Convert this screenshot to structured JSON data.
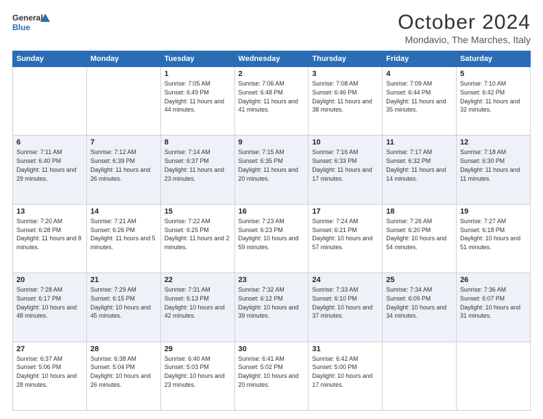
{
  "header": {
    "logo_line1": "General",
    "logo_line2": "Blue",
    "month": "October 2024",
    "location": "Mondavio, The Marches, Italy"
  },
  "weekdays": [
    "Sunday",
    "Monday",
    "Tuesday",
    "Wednesday",
    "Thursday",
    "Friday",
    "Saturday"
  ],
  "weeks": [
    [
      {
        "day": "",
        "sunrise": "",
        "sunset": "",
        "daylight": ""
      },
      {
        "day": "",
        "sunrise": "",
        "sunset": "",
        "daylight": ""
      },
      {
        "day": "1",
        "sunrise": "Sunrise: 7:05 AM",
        "sunset": "Sunset: 6:49 PM",
        "daylight": "Daylight: 11 hours and 44 minutes."
      },
      {
        "day": "2",
        "sunrise": "Sunrise: 7:06 AM",
        "sunset": "Sunset: 6:48 PM",
        "daylight": "Daylight: 11 hours and 41 minutes."
      },
      {
        "day": "3",
        "sunrise": "Sunrise: 7:08 AM",
        "sunset": "Sunset: 6:46 PM",
        "daylight": "Daylight: 11 hours and 38 minutes."
      },
      {
        "day": "4",
        "sunrise": "Sunrise: 7:09 AM",
        "sunset": "Sunset: 6:44 PM",
        "daylight": "Daylight: 11 hours and 35 minutes."
      },
      {
        "day": "5",
        "sunrise": "Sunrise: 7:10 AM",
        "sunset": "Sunset: 6:42 PM",
        "daylight": "Daylight: 11 hours and 32 minutes."
      }
    ],
    [
      {
        "day": "6",
        "sunrise": "Sunrise: 7:11 AM",
        "sunset": "Sunset: 6:40 PM",
        "daylight": "Daylight: 11 hours and 29 minutes."
      },
      {
        "day": "7",
        "sunrise": "Sunrise: 7:12 AM",
        "sunset": "Sunset: 6:39 PM",
        "daylight": "Daylight: 11 hours and 26 minutes."
      },
      {
        "day": "8",
        "sunrise": "Sunrise: 7:14 AM",
        "sunset": "Sunset: 6:37 PM",
        "daylight": "Daylight: 11 hours and 23 minutes."
      },
      {
        "day": "9",
        "sunrise": "Sunrise: 7:15 AM",
        "sunset": "Sunset: 6:35 PM",
        "daylight": "Daylight: 11 hours and 20 minutes."
      },
      {
        "day": "10",
        "sunrise": "Sunrise: 7:16 AM",
        "sunset": "Sunset: 6:33 PM",
        "daylight": "Daylight: 11 hours and 17 minutes."
      },
      {
        "day": "11",
        "sunrise": "Sunrise: 7:17 AM",
        "sunset": "Sunset: 6:32 PM",
        "daylight": "Daylight: 11 hours and 14 minutes."
      },
      {
        "day": "12",
        "sunrise": "Sunrise: 7:18 AM",
        "sunset": "Sunset: 6:30 PM",
        "daylight": "Daylight: 11 hours and 11 minutes."
      }
    ],
    [
      {
        "day": "13",
        "sunrise": "Sunrise: 7:20 AM",
        "sunset": "Sunset: 6:28 PM",
        "daylight": "Daylight: 11 hours and 8 minutes."
      },
      {
        "day": "14",
        "sunrise": "Sunrise: 7:21 AM",
        "sunset": "Sunset: 6:26 PM",
        "daylight": "Daylight: 11 hours and 5 minutes."
      },
      {
        "day": "15",
        "sunrise": "Sunrise: 7:22 AM",
        "sunset": "Sunset: 6:25 PM",
        "daylight": "Daylight: 11 hours and 2 minutes."
      },
      {
        "day": "16",
        "sunrise": "Sunrise: 7:23 AM",
        "sunset": "Sunset: 6:23 PM",
        "daylight": "Daylight: 10 hours and 59 minutes."
      },
      {
        "day": "17",
        "sunrise": "Sunrise: 7:24 AM",
        "sunset": "Sunset: 6:21 PM",
        "daylight": "Daylight: 10 hours and 57 minutes."
      },
      {
        "day": "18",
        "sunrise": "Sunrise: 7:26 AM",
        "sunset": "Sunset: 6:20 PM",
        "daylight": "Daylight: 10 hours and 54 minutes."
      },
      {
        "day": "19",
        "sunrise": "Sunrise: 7:27 AM",
        "sunset": "Sunset: 6:18 PM",
        "daylight": "Daylight: 10 hours and 51 minutes."
      }
    ],
    [
      {
        "day": "20",
        "sunrise": "Sunrise: 7:28 AM",
        "sunset": "Sunset: 6:17 PM",
        "daylight": "Daylight: 10 hours and 48 minutes."
      },
      {
        "day": "21",
        "sunrise": "Sunrise: 7:29 AM",
        "sunset": "Sunset: 6:15 PM",
        "daylight": "Daylight: 10 hours and 45 minutes."
      },
      {
        "day": "22",
        "sunrise": "Sunrise: 7:31 AM",
        "sunset": "Sunset: 6:13 PM",
        "daylight": "Daylight: 10 hours and 42 minutes."
      },
      {
        "day": "23",
        "sunrise": "Sunrise: 7:32 AM",
        "sunset": "Sunset: 6:12 PM",
        "daylight": "Daylight: 10 hours and 39 minutes."
      },
      {
        "day": "24",
        "sunrise": "Sunrise: 7:33 AM",
        "sunset": "Sunset: 6:10 PM",
        "daylight": "Daylight: 10 hours and 37 minutes."
      },
      {
        "day": "25",
        "sunrise": "Sunrise: 7:34 AM",
        "sunset": "Sunset: 6:09 PM",
        "daylight": "Daylight: 10 hours and 34 minutes."
      },
      {
        "day": "26",
        "sunrise": "Sunrise: 7:36 AM",
        "sunset": "Sunset: 6:07 PM",
        "daylight": "Daylight: 10 hours and 31 minutes."
      }
    ],
    [
      {
        "day": "27",
        "sunrise": "Sunrise: 6:37 AM",
        "sunset": "Sunset: 5:06 PM",
        "daylight": "Daylight: 10 hours and 28 minutes."
      },
      {
        "day": "28",
        "sunrise": "Sunrise: 6:38 AM",
        "sunset": "Sunset: 5:04 PM",
        "daylight": "Daylight: 10 hours and 26 minutes."
      },
      {
        "day": "29",
        "sunrise": "Sunrise: 6:40 AM",
        "sunset": "Sunset: 5:03 PM",
        "daylight": "Daylight: 10 hours and 23 minutes."
      },
      {
        "day": "30",
        "sunrise": "Sunrise: 6:41 AM",
        "sunset": "Sunset: 5:02 PM",
        "daylight": "Daylight: 10 hours and 20 minutes."
      },
      {
        "day": "31",
        "sunrise": "Sunrise: 6:42 AM",
        "sunset": "Sunset: 5:00 PM",
        "daylight": "Daylight: 10 hours and 17 minutes."
      },
      {
        "day": "",
        "sunrise": "",
        "sunset": "",
        "daylight": ""
      },
      {
        "day": "",
        "sunrise": "",
        "sunset": "",
        "daylight": ""
      }
    ]
  ]
}
